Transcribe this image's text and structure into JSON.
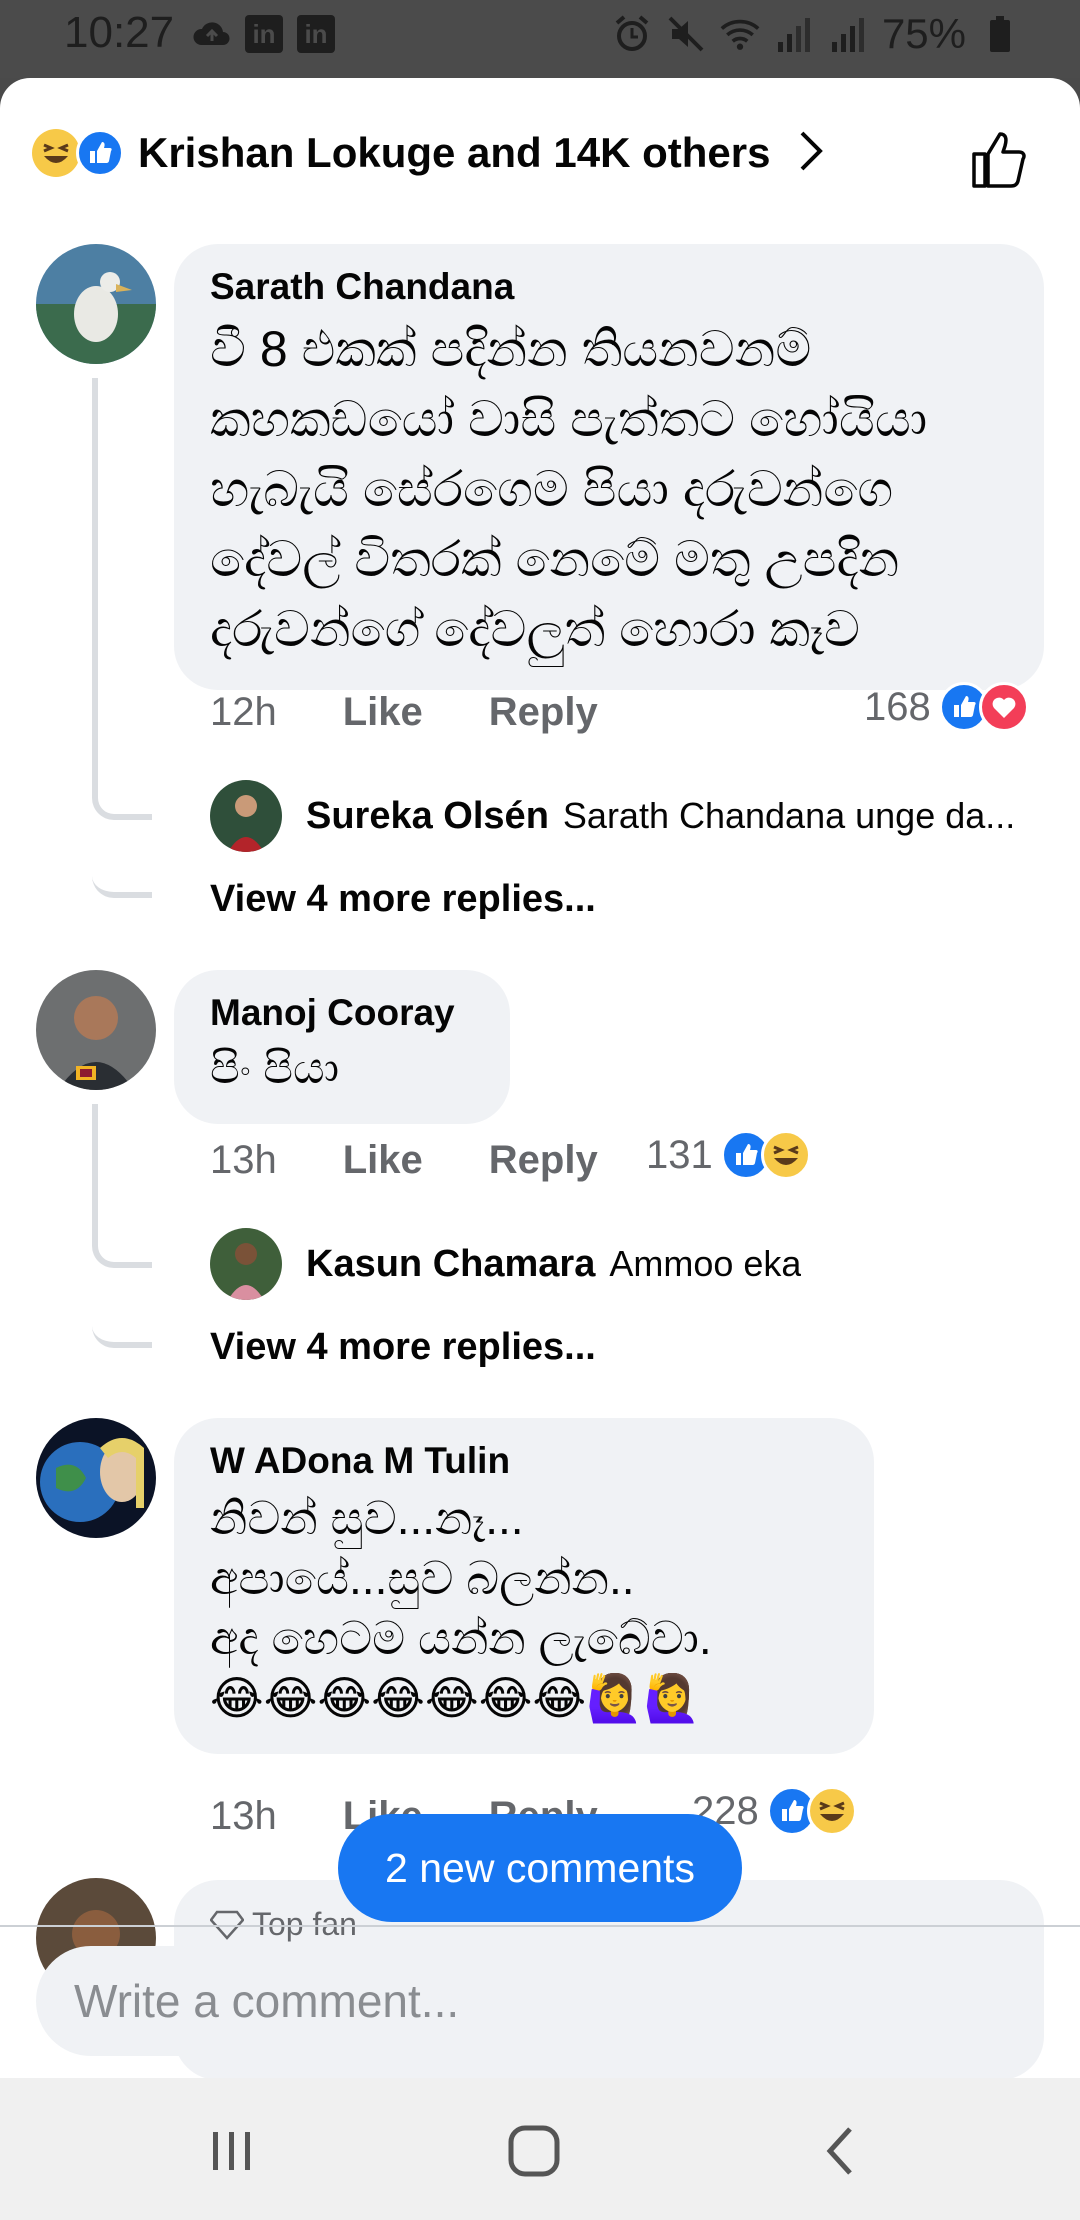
{
  "status_bar": {
    "time": "10:27",
    "battery": "75%",
    "icons": [
      "cloud-upload-icon",
      "linkedin-icon",
      "linkedin-icon",
      "alarm-icon",
      "mute-icon",
      "wifi-icon",
      "signal-icon",
      "signal-icon",
      "battery-icon"
    ]
  },
  "header": {
    "reactions": [
      "haha",
      "like"
    ],
    "text": "Krishan Lokuge and 14K others"
  },
  "comments": [
    {
      "author": "Sarath Chandana",
      "lines": [
        "වී  8 එකක් පදින්න තියනවනම්",
        "කහකඩයෝ වාසි පැත්තට හෝයියා",
        "හැබැයි සේරගෙම පියා දරුවන්ගෙ",
        "දේවල් විතරක් නෙමේ මතු උපදින",
        "දරුවන්ගේ දේවලුත් හොරා කෑව"
      ],
      "time": "12h",
      "like": "Like",
      "reply": "Reply",
      "count": "168",
      "reactions": [
        "like",
        "love"
      ],
      "reply_preview": {
        "author": "Sureka Olsén",
        "text": "Sarath Chandana unge da..."
      },
      "view_more": "View 4 more replies..."
    },
    {
      "author": "Manoj Cooray",
      "lines": [
        "පිං පියා"
      ],
      "time": "13h",
      "like": "Like",
      "reply": "Reply",
      "count": "131",
      "reactions": [
        "like",
        "haha"
      ],
      "reply_preview": {
        "author": "Kasun Chamara",
        "text": "Ammoo eka"
      },
      "view_more": "View 4 more replies..."
    },
    {
      "author": "W ADona M Tulin",
      "lines": [
        "නිවන් සුව...නෑ...",
        "අපායේ...සුව  බලන්න..",
        "අද  හෙටම  යන්න  ලැබේවා."
      ],
      "emoji_line": "😂😂😂😂😂😂😂🙋‍♀️🙋‍♀️",
      "time": "13h",
      "like": "Like",
      "reply": "Reply",
      "count": "228",
      "reactions": [
        "like",
        "haha"
      ]
    }
  ],
  "partial": {
    "badge": "Top fan"
  },
  "new_comments_label": "2 new comments",
  "composer": {
    "placeholder": "Write a comment..."
  },
  "navbar": {
    "buttons": [
      "recent-apps-icon",
      "home-icon",
      "back-icon"
    ]
  }
}
